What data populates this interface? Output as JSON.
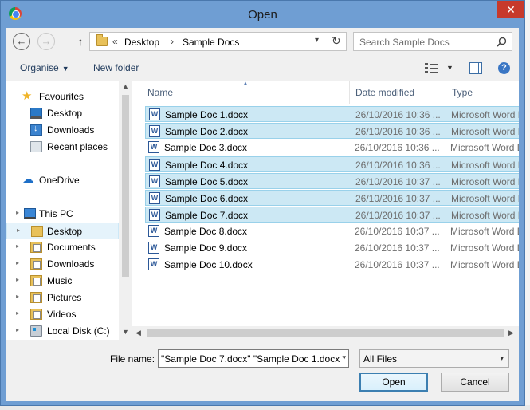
{
  "window": {
    "title": "Open",
    "close_glyph": "✕"
  },
  "nav": {
    "back_glyph": "←",
    "forward_glyph": "→",
    "up_glyph": "↑",
    "breadcrumb_prefix": "«",
    "breadcrumb": [
      "Desktop",
      "Sample Docs"
    ],
    "separator": "›",
    "dropdown_glyph": "▾",
    "refresh_glyph": "↻",
    "search_placeholder": "Search Sample Docs"
  },
  "toolbar": {
    "organise": "Organise",
    "organise_caret": "▼",
    "new_folder": "New folder",
    "view_caret": "▼",
    "help": "?"
  },
  "sidebar": {
    "favourites": {
      "label": "Favourites",
      "icon": "star-icon"
    },
    "favourite_items": [
      {
        "label": "Desktop",
        "icon": "desktop-icon"
      },
      {
        "label": "Downloads",
        "icon": "downloads-icon"
      },
      {
        "label": "Recent places",
        "icon": "recent-places-icon"
      }
    ],
    "onedrive": {
      "label": "OneDrive",
      "icon": "cloud-icon"
    },
    "thispc": {
      "label": "This PC",
      "icon": "computer-icon"
    },
    "pc_items": [
      {
        "label": "Desktop",
        "icon": "desktop-folder-icon",
        "selected": true
      },
      {
        "label": "Documents",
        "icon": "documents-folder-icon"
      },
      {
        "label": "Downloads",
        "icon": "downloads-folder-icon"
      },
      {
        "label": "Music",
        "icon": "music-folder-icon"
      },
      {
        "label": "Pictures",
        "icon": "pictures-folder-icon"
      },
      {
        "label": "Videos",
        "icon": "videos-folder-icon"
      },
      {
        "label": "Local Disk (C:)",
        "icon": "local-disk-icon"
      }
    ],
    "expand_glyph": "▸"
  },
  "scroll": {
    "up": "▲",
    "down": "▼",
    "left": "◀",
    "right": "▶"
  },
  "filelist": {
    "columns": {
      "name": "Name",
      "date": "Date modified",
      "type": "Type"
    },
    "sort_glyph": "▲",
    "doc_icon_letter": "W",
    "rows": [
      {
        "name": "Sample Doc 1.docx",
        "date": "26/10/2016 10:36 ...",
        "type": "Microsoft Word D",
        "selected": true
      },
      {
        "name": "Sample Doc 2.docx",
        "date": "26/10/2016 10:36 ...",
        "type": "Microsoft Word D",
        "selected": true
      },
      {
        "name": "Sample Doc 3.docx",
        "date": "26/10/2016 10:36 ...",
        "type": "Microsoft Word D",
        "selected": false
      },
      {
        "name": "Sample Doc 4.docx",
        "date": "26/10/2016 10:36 ...",
        "type": "Microsoft Word D",
        "selected": true
      },
      {
        "name": "Sample Doc 5.docx",
        "date": "26/10/2016 10:37 ...",
        "type": "Microsoft Word D",
        "selected": true
      },
      {
        "name": "Sample Doc 6.docx",
        "date": "26/10/2016 10:37 ...",
        "type": "Microsoft Word D",
        "selected": true
      },
      {
        "name": "Sample Doc 7.docx",
        "date": "26/10/2016 10:37 ...",
        "type": "Microsoft Word D",
        "selected": true
      },
      {
        "name": "Sample Doc 8.docx",
        "date": "26/10/2016 10:37 ...",
        "type": "Microsoft Word D",
        "selected": false
      },
      {
        "name": "Sample Doc 9.docx",
        "date": "26/10/2016 10:37 ...",
        "type": "Microsoft Word D",
        "selected": false
      },
      {
        "name": "Sample Doc 10.docx",
        "date": "26/10/2016 10:37 ...",
        "type": "Microsoft Word D",
        "selected": false
      }
    ]
  },
  "footer": {
    "file_name_label": "File name:",
    "file_name_value": "\"Sample Doc 7.docx\" \"Sample Doc 1.docx",
    "dropdown_glyph": "▾",
    "filter_value": "All Files",
    "filter_glyph": "▾",
    "open": "Open",
    "cancel": "Cancel"
  }
}
